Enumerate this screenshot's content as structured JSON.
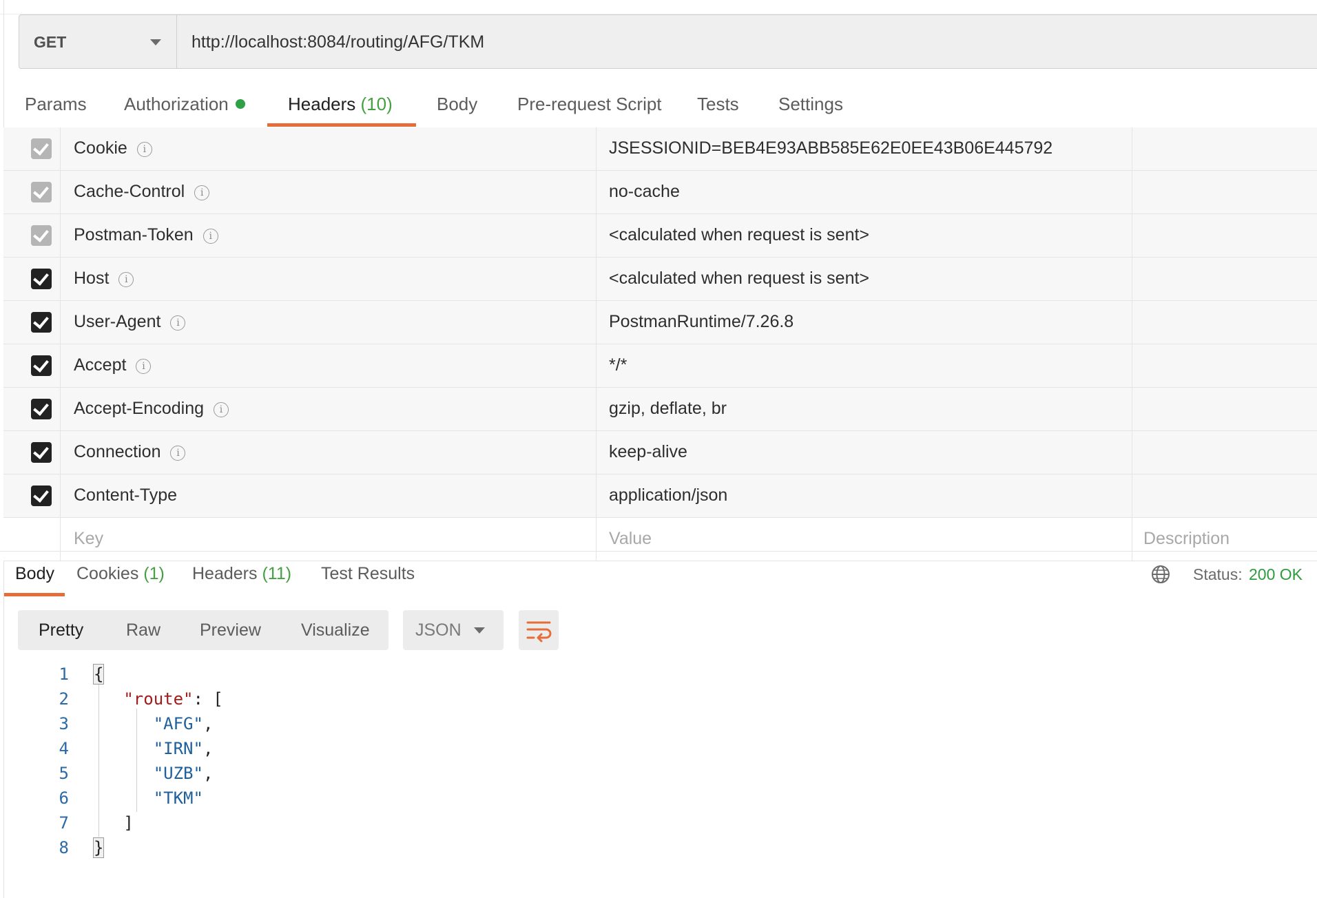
{
  "request": {
    "method": "GET",
    "url": "http://localhost:8084/routing/AFG/TKM"
  },
  "request_tabs": [
    {
      "label": "Params",
      "count": ""
    },
    {
      "label": "Authorization",
      "count": ""
    },
    {
      "label": "Headers",
      "count": "(10)"
    },
    {
      "label": "Body",
      "count": ""
    },
    {
      "label": "Pre-request Script",
      "count": ""
    },
    {
      "label": "Tests",
      "count": ""
    },
    {
      "label": "Settings",
      "count": ""
    }
  ],
  "headers": [
    {
      "key": "Cookie",
      "value": "JSESSIONID=BEB4E93ABB585E62E0EE43B06E445792",
      "checked": true,
      "auto": true
    },
    {
      "key": "Cache-Control",
      "value": "no-cache",
      "checked": true,
      "auto": true
    },
    {
      "key": "Postman-Token",
      "value": "<calculated when request is sent>",
      "checked": true,
      "auto": true
    },
    {
      "key": "Host",
      "value": "<calculated when request is sent>",
      "checked": true,
      "auto": false
    },
    {
      "key": "User-Agent",
      "value": "PostmanRuntime/7.26.8",
      "checked": true,
      "auto": false
    },
    {
      "key": "Accept",
      "value": "*/*",
      "checked": true,
      "auto": false
    },
    {
      "key": "Accept-Encoding",
      "value": "gzip, deflate, br",
      "checked": true,
      "auto": false
    },
    {
      "key": "Connection",
      "value": "keep-alive",
      "checked": true,
      "auto": false
    },
    {
      "key": "Content-Type",
      "value": "application/json",
      "checked": true,
      "auto": false
    }
  ],
  "new_header_placeholders": {
    "key": "Key",
    "value": "Value",
    "description": "Description"
  },
  "response_tabs": [
    {
      "label": "Body",
      "count": ""
    },
    {
      "label": "Cookies",
      "count": "(1)"
    },
    {
      "label": "Headers",
      "count": "(11)"
    },
    {
      "label": "Test Results",
      "count": ""
    }
  ],
  "status": {
    "label": "Status:",
    "value": "200 OK"
  },
  "view_modes": [
    "Pretty",
    "Raw",
    "Preview",
    "Visualize"
  ],
  "format": "JSON",
  "code_lines": [
    "1",
    "2",
    "3",
    "4",
    "5",
    "6",
    "7",
    "8"
  ],
  "response_json": {
    "key": "\"route\"",
    "values": [
      "\"AFG\"",
      "\"IRN\"",
      "\"UZB\"",
      "\"TKM\""
    ]
  },
  "colors": {
    "accent": "#e46d3a",
    "success": "#2e9b3e",
    "auth_dot": "#2fa045"
  },
  "icons": [
    "chevron-down-icon",
    "info-icon",
    "checkbox-icon",
    "globe-icon",
    "wrap-lines-icon"
  ]
}
